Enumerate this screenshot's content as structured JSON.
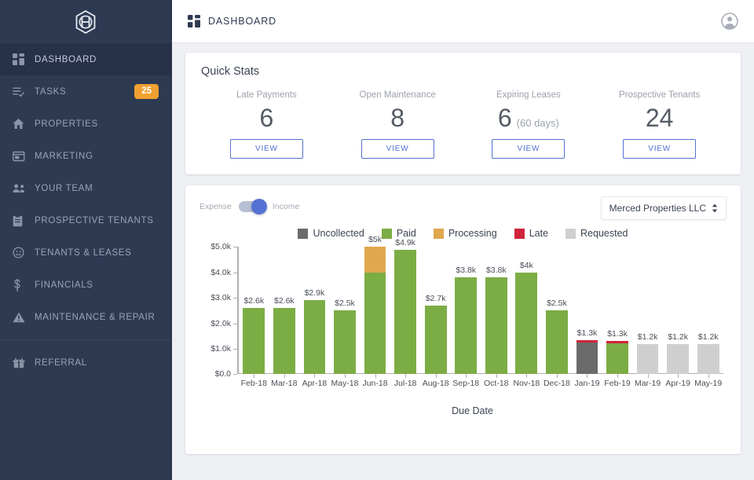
{
  "brand": {
    "logo_icon": "hexagon-h-logo",
    "sidebar_bg": "#2e3a52",
    "accent": "#5472d3",
    "badge_color": "#f0a030"
  },
  "sidebar": {
    "items": [
      {
        "label": "DASHBOARD",
        "icon": "dashboard-grid-icon",
        "active": true,
        "badge": null
      },
      {
        "label": "TASKS",
        "icon": "tasks-checklist-icon",
        "active": false,
        "badge": "25"
      },
      {
        "label": "PROPERTIES",
        "icon": "home-icon",
        "active": false,
        "badge": null
      },
      {
        "label": "MARKETING",
        "icon": "card-window-icon",
        "active": false,
        "badge": null
      },
      {
        "label": "YOUR TEAM",
        "icon": "people-group-icon",
        "active": false,
        "badge": null
      },
      {
        "label": "PROSPECTIVE TENANTS",
        "icon": "clipboard-icon",
        "active": false,
        "badge": null
      },
      {
        "label": "TENANTS & LEASES",
        "icon": "face-circle-icon",
        "active": false,
        "badge": null
      },
      {
        "label": "FINANCIALS",
        "icon": "dollar-sign-icon",
        "active": false,
        "badge": null
      },
      {
        "label": "MAINTENANCE & REPAIR",
        "icon": "warning-triangle-icon",
        "active": false,
        "badge": null
      }
    ],
    "footer_items": [
      {
        "label": "REFERRAL",
        "icon": "gift-box-icon",
        "active": false,
        "badge": null
      }
    ]
  },
  "topbar": {
    "icon": "dashboard-grid-icon",
    "title": "DASHBOARD",
    "account_icon": "user-account-icon"
  },
  "quick_stats": {
    "title": "Quick Stats",
    "items": [
      {
        "label": "Late Payments",
        "value": "6",
        "sub": "",
        "button": "VIEW"
      },
      {
        "label": "Open Maintenance",
        "value": "8",
        "sub": "",
        "button": "VIEW"
      },
      {
        "label": "Expiring Leases",
        "value": "6",
        "sub": "(60 days)",
        "button": "VIEW"
      },
      {
        "label": "Prospective Tenants",
        "value": "24",
        "sub": "",
        "button": "VIEW"
      }
    ]
  },
  "chart_panel": {
    "toggle": {
      "left_label": "Expense",
      "right_label": "Income",
      "selected": "Income"
    },
    "property_select": {
      "value": "Merced Properties LLC",
      "caret_icon": "select-updown-caret-icon"
    }
  },
  "chart_data": {
    "type": "bar",
    "stacked": true,
    "title": "",
    "xlabel": "Due Date",
    "ylabel": "",
    "ylim": [
      0,
      5000
    ],
    "grid": false,
    "legend_position": "top-center",
    "ytick_labels": [
      "$0.0",
      "$1.0k",
      "$2.0k",
      "$3.0k",
      "$4.0k",
      "$5.0k"
    ],
    "ytick_values": [
      0,
      1000,
      2000,
      3000,
      4000,
      5000
    ],
    "legend": [
      {
        "name": "Uncollected",
        "color": "#6b6b6b"
      },
      {
        "name": "Paid",
        "color": "#7cad45"
      },
      {
        "name": "Processing",
        "color": "#e0a84e"
      },
      {
        "name": "Late",
        "color": "#d0243c"
      },
      {
        "name": "Requested",
        "color": "#cfcfcf"
      }
    ],
    "categories": [
      "Feb-18",
      "Mar-18",
      "Apr-18",
      "May-18",
      "Jun-18",
      "Jul-18",
      "Aug-18",
      "Sep-18",
      "Oct-18",
      "Nov-18",
      "Dec-18",
      "Jan-19",
      "Feb-19",
      "Mar-19",
      "Apr-19",
      "May-19"
    ],
    "totals_labels": [
      "$2.6k",
      "$2.6k",
      "$2.9k",
      "$2.5k",
      "$5k",
      "$4.9k",
      "$2.7k",
      "$3.8k",
      "$3.8k",
      "$4k",
      "$2.5k",
      "$1.3k",
      "$1.3k",
      "$1.2k",
      "$1.2k",
      "$1.2k"
    ],
    "series": [
      {
        "name": "Uncollected",
        "color": "#6b6b6b",
        "values": [
          0,
          0,
          0,
          0,
          0,
          0,
          0,
          0,
          0,
          0,
          0,
          1250,
          0,
          0,
          0,
          0
        ]
      },
      {
        "name": "Paid",
        "color": "#7cad45",
        "values": [
          2600,
          2600,
          2900,
          2500,
          4000,
          4900,
          2700,
          3800,
          3800,
          4000,
          2500,
          0,
          1230,
          0,
          0,
          0
        ]
      },
      {
        "name": "Processing",
        "color": "#e0a84e",
        "values": [
          0,
          0,
          0,
          0,
          1000,
          0,
          0,
          0,
          0,
          0,
          0,
          0,
          0,
          0,
          0,
          0
        ]
      },
      {
        "name": "Late",
        "color": "#d0243c",
        "values": [
          0,
          0,
          0,
          0,
          0,
          0,
          0,
          0,
          0,
          0,
          0,
          80,
          90,
          0,
          0,
          0
        ]
      },
      {
        "name": "Requested",
        "color": "#cfcfcf",
        "values": [
          0,
          0,
          0,
          0,
          0,
          0,
          0,
          0,
          0,
          0,
          0,
          0,
          0,
          1200,
          1200,
          1200
        ]
      }
    ]
  }
}
